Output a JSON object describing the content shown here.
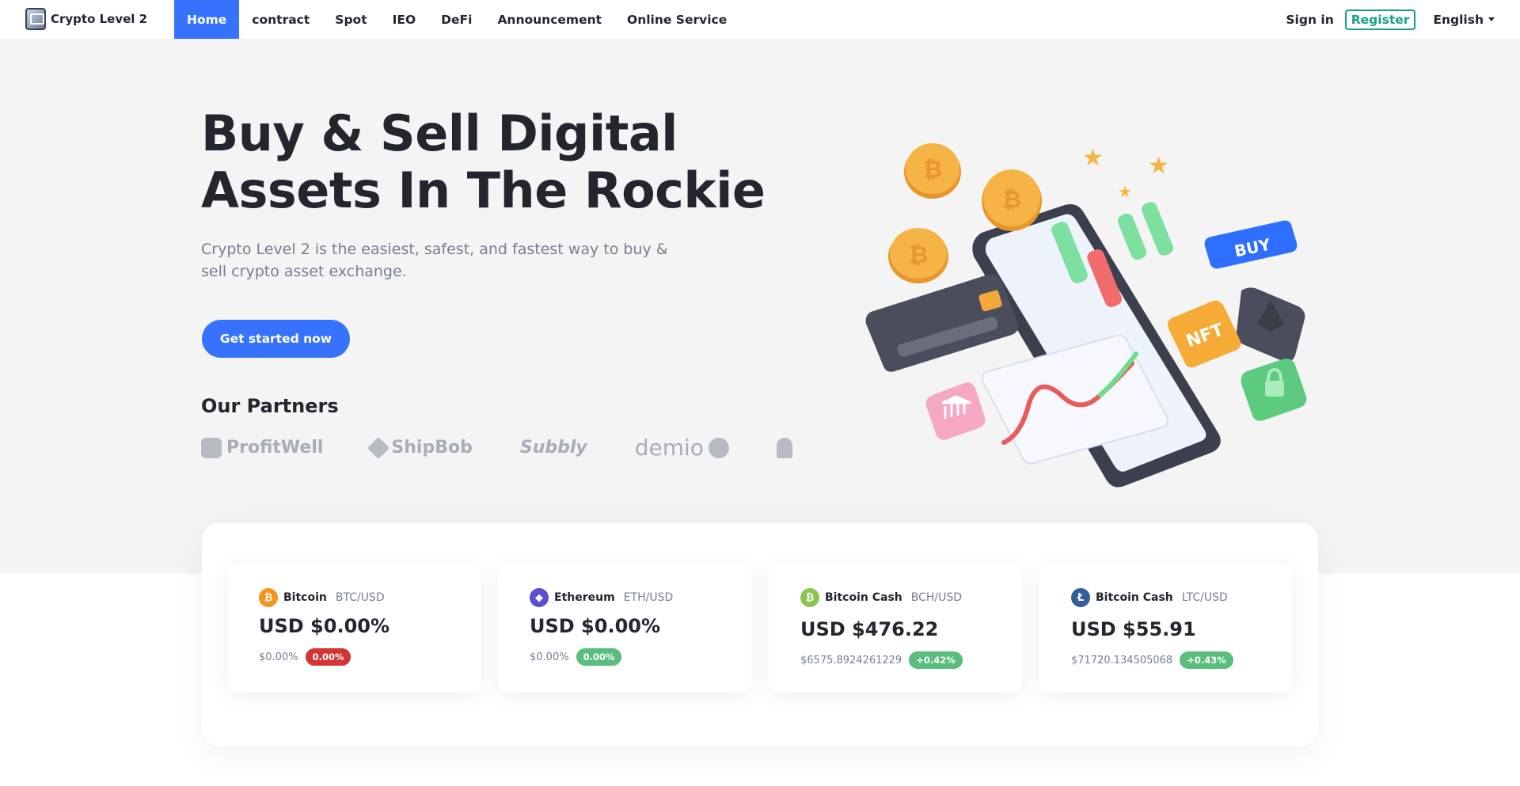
{
  "brand": {
    "name": "Crypto Level 2",
    "logo_icon": "crypto-level-logo"
  },
  "nav": {
    "links": [
      {
        "label": "Home",
        "active": true
      },
      {
        "label": "contract",
        "active": false
      },
      {
        "label": "Spot",
        "active": false
      },
      {
        "label": "IEO",
        "active": false
      },
      {
        "label": "DeFi",
        "active": false
      },
      {
        "label": "Announcement",
        "active": false
      },
      {
        "label": "Online Service",
        "active": false
      }
    ],
    "signin": "Sign in",
    "register": "Register",
    "language": "English"
  },
  "hero": {
    "title_line1": "Buy & Sell Digital",
    "title_line2": "Assets In The Rockie",
    "subtitle": "Crypto Level 2 is the easiest, safest, and fastest way to buy & sell crypto asset exchange.",
    "cta": "Get started now",
    "partners_title": "Our Partners",
    "partners": [
      "ProfitWell",
      "ShipBob",
      "Subbly",
      "demio"
    ],
    "illustration_labels": {
      "buy": "BUY",
      "nft": "NFT"
    }
  },
  "tickers": [
    {
      "name": "Bitcoin",
      "pair": "BTC/USD",
      "price": "USD $0.00%",
      "sub": "$0.00%",
      "change": "0.00%",
      "change_color": "#d33535",
      "coin_color": "#f7931a",
      "coin_symbol": "₿"
    },
    {
      "name": "Ethereum",
      "pair": "ETH/USD",
      "price": "USD $0.00%",
      "sub": "$0.00%",
      "change": "0.00%",
      "change_color": "#58bd7d",
      "coin_color": "#5a4fcf",
      "coin_symbol": "◆"
    },
    {
      "name": "Bitcoin Cash",
      "pair": "BCH/USD",
      "price": "USD $476.22",
      "sub": "$6575.8924261229",
      "change": "+0.42%",
      "change_color": "#58bd7d",
      "coin_color": "#8dc351",
      "coin_symbol": "₿"
    },
    {
      "name": "Bitcoin Cash",
      "pair": "LTC/USD",
      "price": "USD $55.91",
      "sub": "$71720.134505068",
      "change": "+0.43%",
      "change_color": "#58bd7d",
      "coin_color": "#345d9d",
      "coin_symbol": "Ł"
    }
  ],
  "colors": {
    "accent": "#3772ff",
    "register": "#16a085",
    "hero_bg": "#f4f4f5"
  }
}
